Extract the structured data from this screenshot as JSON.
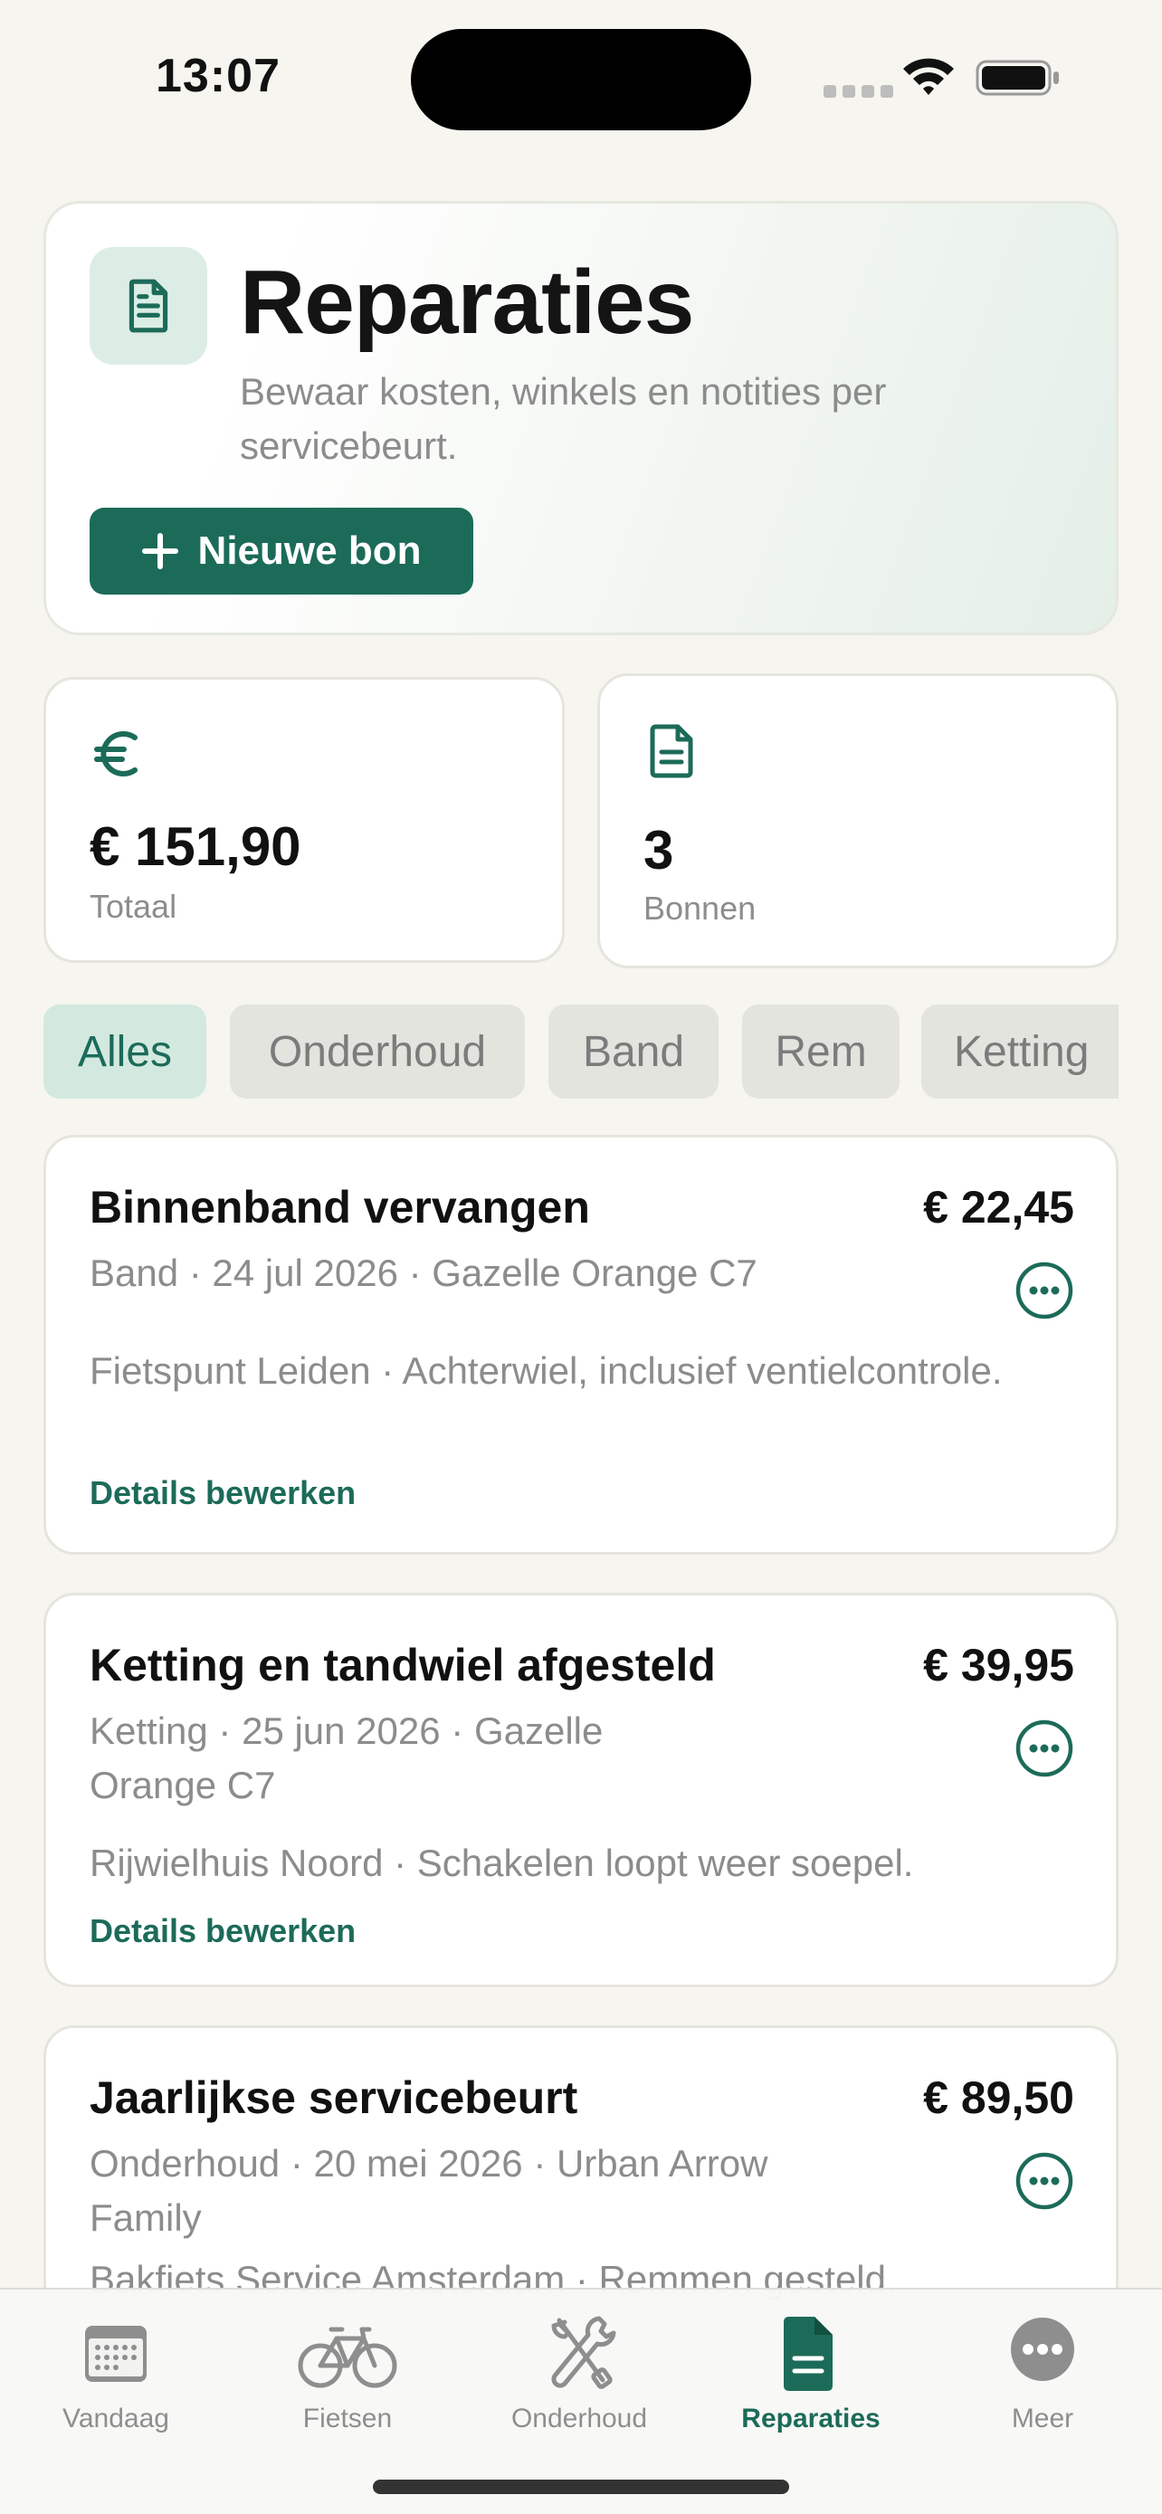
{
  "status_bar": {
    "time": "13:07"
  },
  "header": {
    "title": "Reparaties",
    "subtitle": "Bewaar kosten, winkels en notities per servicebeurt.",
    "new_button_label": "Nieuwe bon",
    "icon": "document-icon"
  },
  "stats": [
    {
      "icon": "euro-icon",
      "value": "€ 151,90",
      "label": "Totaal"
    },
    {
      "icon": "document-icon",
      "value": "3",
      "label": "Bonnen"
    }
  ],
  "filters": {
    "selected": "Alles",
    "chips": [
      "Alles",
      "Onderhoud",
      "Band",
      "Rem",
      "Ketting"
    ]
  },
  "repairs": [
    {
      "title": "Binnenband vervangen",
      "amount": "€ 22,45",
      "meta": "Band · 24 jul 2026 · Gazelle Orange C7",
      "note": "Fietspunt Leiden · Achterwiel, inclusief ventielcontrole.",
      "link": "Details bewerken"
    },
    {
      "title": "Ketting en tandwiel afgesteld",
      "amount": "€ 39,95",
      "meta": "Ketting · 25 jun 2026 · Gazelle Orange C7",
      "note": "Rijwielhuis Noord · Schakelen loopt weer soepel.",
      "link": "Details bewerken"
    },
    {
      "title": "Jaarlijkse servicebeurt",
      "amount": "€ 89,50",
      "meta": "Onderhoud · 20 mei 2026 · Urban Arrow Family",
      "note": "Bakfiets Service Amsterdam · Remmen gesteld."
    }
  ],
  "tabs": [
    {
      "label": "Vandaag",
      "icon": "calendar-icon"
    },
    {
      "label": "Fietsen",
      "icon": "bicycle-icon"
    },
    {
      "label": "Onderhoud",
      "icon": "tools-icon"
    },
    {
      "label": "Reparaties",
      "icon": "document-icon",
      "active": true
    },
    {
      "label": "Meer",
      "icon": "more-icon"
    }
  ],
  "colors": {
    "accent": "#1C6B59",
    "accent_light": "#D3E9E0",
    "background": "#F6F5EF",
    "muted_text": "#8C8C8C"
  }
}
